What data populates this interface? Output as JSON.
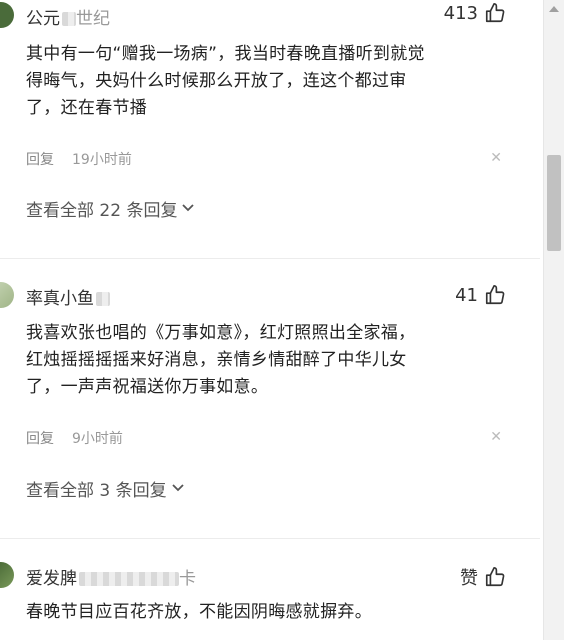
{
  "comments": [
    {
      "username": "公元",
      "username_suffix": "世纪",
      "likes": "413",
      "text_lines": [
        "其中有一句“赠我一场病”，我当时春晚直播听到就觉",
        "得晦气，央妈什么时候那么开放了，连这个都过审",
        "了，还在春节播"
      ],
      "reply_label": "回复",
      "time": "19小时前",
      "view_all": "查看全部 22 条回复"
    },
    {
      "username": "率真小鱼",
      "likes": "41",
      "text_lines": [
        "我喜欢张也唱的《万事如意》，红灯照照出全家福，",
        "红烛摇摇摇摇来好消息，亲情乡情甜醉了中华儿女",
        "了，一声声祝福送你万事如意。"
      ],
      "reply_label": "回复",
      "time": "9小时前",
      "view_all": "查看全部 3 条回复"
    },
    {
      "username": "爱发脾",
      "username_suffix": "卡",
      "likes": "赞",
      "text_lines": [
        "春晚节目应百花齐放，不能因阴晦感就摒弃。"
      ]
    }
  ],
  "icons": {
    "like": "thumbs-up-icon",
    "close": "close-icon",
    "expand": "chevron-down-icon"
  },
  "colors": {
    "text": "#222222",
    "meta": "#999999",
    "background": "#ffffff"
  }
}
